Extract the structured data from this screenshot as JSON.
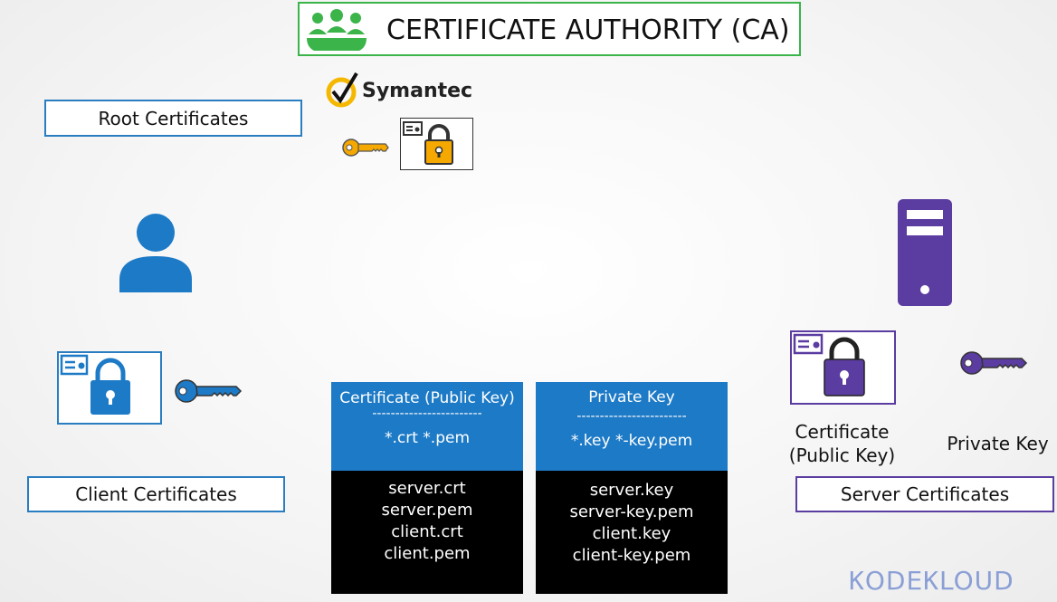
{
  "title": "CERTIFICATE AUTHORITY (CA)",
  "ca_brand": "Symantec",
  "labels": {
    "root": "Root Certificates",
    "client": "Client Certificates",
    "server": "Server Certificates",
    "server_cert_line1": "Certificate",
    "server_cert_line2": "(Public Key)",
    "server_private_key": "Private Key"
  },
  "columns": [
    {
      "header": "Certificate (Public Key)",
      "divider": "------------------------",
      "extensions": "*.crt  *.pem",
      "files": [
        "server.crt",
        "server.pem",
        "client.crt",
        "client.pem"
      ]
    },
    {
      "header": "Private Key",
      "divider": "------------------------",
      "extensions": "*.key  *-key.pem",
      "files": [
        "server.key",
        "server-key.pem",
        "client.key",
        "client-key.pem"
      ]
    }
  ],
  "logo": {
    "part1": "K",
    "part2": "ODE",
    "part3": "K",
    "part4": "LOUD"
  },
  "colors": {
    "title_border": "#3bb44a",
    "ca_gold": "#f5a800",
    "client_blue": "#1d7ac6",
    "server_purple": "#5b3ca0",
    "logo": "#8a9fd6"
  },
  "icons": [
    "group-icon",
    "symantec-check-icon",
    "gold-key-icon",
    "gold-certificate-icon",
    "user-icon",
    "client-certificate-icon",
    "blue-key-icon",
    "server-icon",
    "server-certificate-icon",
    "purple-key-icon"
  ]
}
